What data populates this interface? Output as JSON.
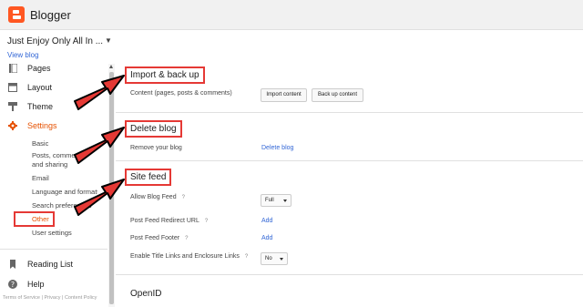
{
  "header": {
    "app_name": "Blogger"
  },
  "blog": {
    "name": "Just Enjoy Only All In ...",
    "view_blog": "View blog"
  },
  "sidebar": {
    "items": [
      {
        "label": "Pages",
        "icon": "pages-icon"
      },
      {
        "label": "Layout",
        "icon": "layout-icon"
      },
      {
        "label": "Theme",
        "icon": "theme-icon"
      },
      {
        "label": "Settings",
        "icon": "settings-gear-icon"
      }
    ],
    "sub_items": [
      "Basic",
      "Posts, comments and sharing",
      "Email",
      "Language and formatting",
      "Search preferences",
      "Other",
      "User settings"
    ],
    "bottom_items": [
      {
        "label": "Reading List",
        "icon": "bookmark-icon"
      },
      {
        "label": "Help",
        "icon": "help-icon"
      }
    ],
    "footer": "Terms of Service | Privacy | Content Policy"
  },
  "sections": {
    "import": {
      "title": "Import & back up",
      "row_label": "Content (pages, posts & comments)",
      "import_btn": "Import content",
      "backup_btn": "Back up content"
    },
    "delete": {
      "title": "Delete blog",
      "row_label": "Remove your blog",
      "action": "Delete blog"
    },
    "feed": {
      "title": "Site feed",
      "allow_label": "Allow Blog Feed",
      "allow_value": "Full",
      "redirect_label": "Post Feed Redirect URL",
      "redirect_action": "Add",
      "footer_label": "Post Feed Footer",
      "footer_action": "Add",
      "enclosure_label": "Enable Title Links and Enclosure Links",
      "enclosure_value": "No",
      "help_glyph": "?"
    },
    "openid": {
      "title": "OpenID"
    }
  },
  "colors": {
    "accent": "#ff5722",
    "annotation": "#e53935",
    "link": "#3367d6"
  }
}
